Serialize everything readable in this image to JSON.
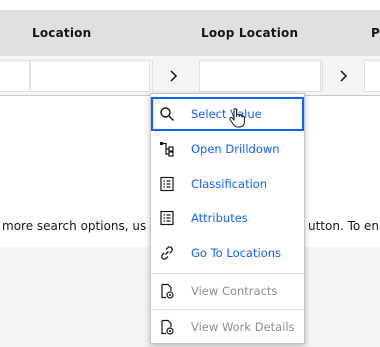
{
  "table": {
    "columns": [
      {
        "label": "Location"
      },
      {
        "label": "Loop Location"
      },
      {
        "label": "P"
      }
    ]
  },
  "help": {
    "left": "more search options, us",
    "right": "utton. To en"
  },
  "menu": {
    "items": [
      {
        "label": "Select Value",
        "icon": "search-icon",
        "state": "selected"
      },
      {
        "label": "Open Drilldown",
        "icon": "drilldown-icon",
        "state": "enabled"
      },
      {
        "label": "Classification",
        "icon": "list-icon",
        "state": "enabled"
      },
      {
        "label": "Attributes",
        "icon": "list-icon",
        "state": "enabled"
      },
      {
        "label": "Go To Locations",
        "icon": "link-icon",
        "state": "enabled"
      },
      {
        "label": "View Contracts",
        "icon": "document-view-icon",
        "state": "disabled"
      },
      {
        "label": "View Work Details",
        "icon": "document-view-icon",
        "state": "disabled"
      }
    ]
  },
  "colors": {
    "link": "#0f62fe",
    "disabled": "#8d8d8d",
    "header_bg": "#e0e0e0",
    "filter_bg": "#f4f4f4"
  }
}
